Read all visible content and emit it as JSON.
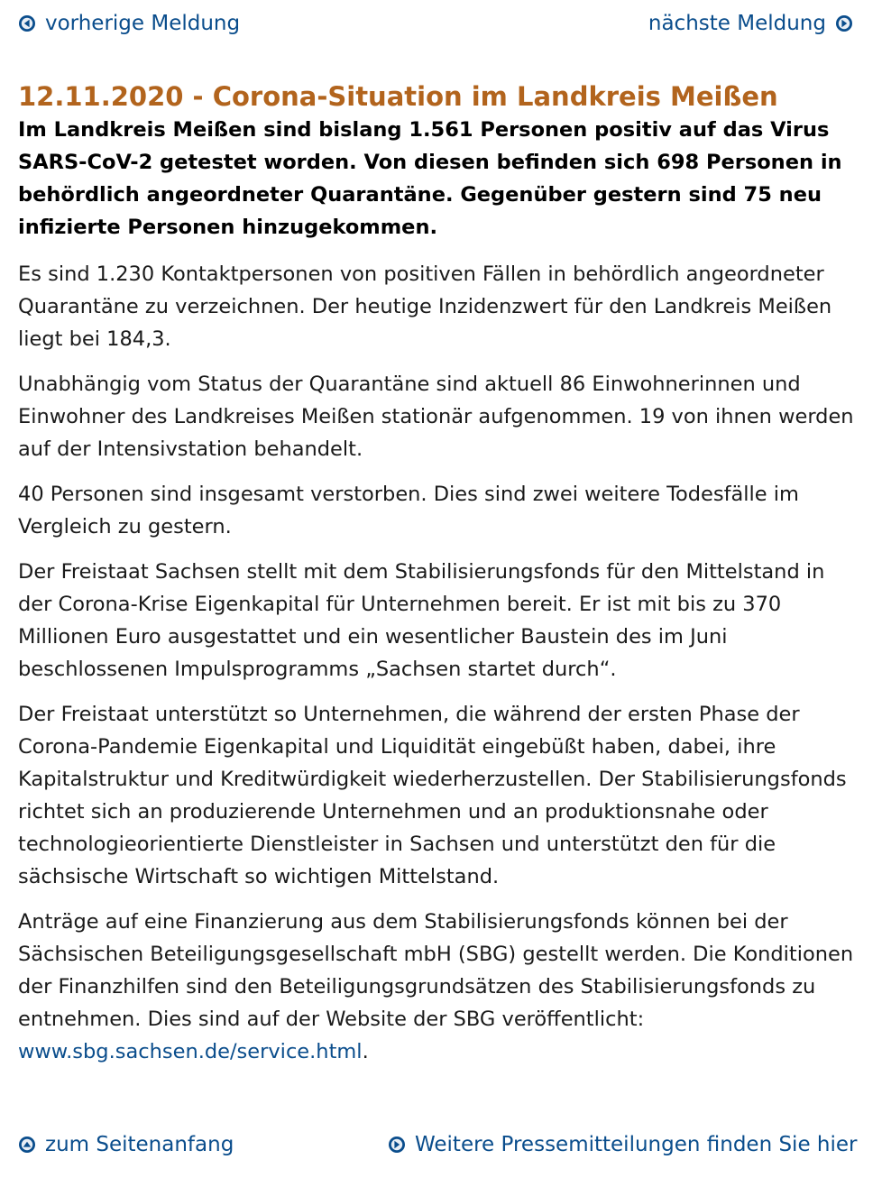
{
  "nav": {
    "prev_label": "vorherige Meldung",
    "next_label": "nächste Meldung",
    "prev_icon": "circle-arrow-left-icon",
    "next_icon": "circle-arrow-right-icon"
  },
  "article": {
    "title": "12.11.2020 - Corona-Situation im Landkreis Meißen",
    "lead": "Im Landkreis Meißen sind bislang 1.561 Personen positiv auf das Virus SARS-CoV-2 getestet worden. Von diesen befinden sich 698 Personen in behördlich angeordneter Quarantäne. Gegenüber gestern sind 75 neu infizierte Personen hinzugekommen.",
    "paragraphs": [
      "Es sind 1.230 Kontaktpersonen von positiven Fällen in behördlich angeordneter Quarantäne zu verzeichnen. Der heutige Inzidenzwert für den Landkreis Meißen liegt bei 184,3.",
      "Unabhängig vom Status der Quarantäne sind aktuell 86 Einwohnerinnen und Einwohner des Landkreises Meißen stationär aufgenommen. 19 von ihnen werden auf der Intensivstation behandelt.",
      "40 Personen sind insgesamt verstorben. Dies sind zwei weitere Todesfälle im Vergleich zu gestern.",
      "Der Freistaat Sachsen stellt mit dem Stabilisierungsfonds für den Mittelstand in der Corona-Krise Eigenkapital für Unternehmen bereit. Er ist mit bis zu 370 Millionen Euro ausgestattet und ein wesentlicher Baustein des im Juni beschlossenen Impulsprogramms „Sachsen startet durch“.",
      "Der Freistaat unterstützt so Unternehmen, die während der ersten Phase der Corona-Pandemie Eigenkapital und Liquidität eingebüßt haben, dabei, ihre Kapitalstruktur und Kreditwürdigkeit wiederherzustellen. Der Stabilisierungsfonds richtet sich an produzierende Unternehmen und an produktionsnahe oder technologieorientierte Dienstleister in Sachsen und unterstützt den für die sächsische Wirtschaft so wichtigen Mittelstand."
    ],
    "last_paragraph": {
      "text": "Anträge auf eine Finanzierung aus dem Stabilisierungsfonds können bei der Sächsischen Beteiligungsgesellschaft mbH (SBG) gestellt werden. Die Konditionen der Finanzhilfen sind den Beteiligungsgrundsätzen des Stabilisierungsfonds zu entnehmen. Dies sind auf der Website der SBG veröffentlicht: ",
      "link_text": "www.sbg.sachsen.de/service.html",
      "suffix": "."
    }
  },
  "footer": {
    "top_label": "zum Seitenanfang",
    "more_label": "Weitere Pressemitteilungen finden Sie hier",
    "top_icon": "circle-arrow-up-icon",
    "more_icon": "circle-arrow-right-icon"
  },
  "colors": {
    "link": "#0a4d8c",
    "title": "#b2641d",
    "icon_ring": "#0a4d8c",
    "icon_fill": "#ffffff"
  }
}
